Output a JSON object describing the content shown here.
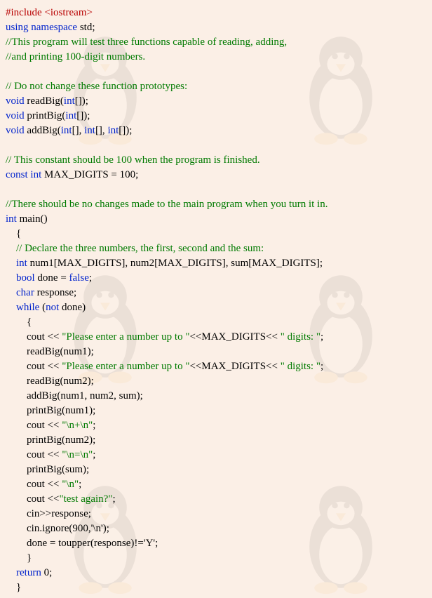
{
  "code": {
    "include_line": "#include <iostream>",
    "using_kw": "using",
    "namespace_kw": "namespace",
    "std_stmt": " std;",
    "c1": "//This program will test three functions capable of reading, adding,",
    "c2": "//and printing 100-digit numbers.",
    "c3": "// Do not change these function prototypes:",
    "void_kw": "void",
    "readBig_proto": " readBig(",
    "int_kw": "int",
    "arr_close": "[]);",
    "printBig_proto": " printBig(",
    "addBig_proto": " addBig(",
    "arr_mid": "[], ",
    "c4": "// This constant should be 100 when the program is finished.",
    "const_kw": "const",
    "max_digits_decl": " MAX_DIGITS = 100;",
    "c5": "//There should be no changes made to the main program when you turn it in.",
    "main_fn": " main()",
    "brace_open": "{",
    "brace_close": "}",
    "c6": "// Declare the three numbers, the first, second and the sum:",
    "decl_arrays": " num1[MAX_DIGITS], num2[MAX_DIGITS], sum[MAX_DIGITS];",
    "bool_kw": "bool",
    "done_false": " done = ",
    "false_kw": "false",
    "semi": ";",
    "char_kw": "char",
    "resp_decl": " response;",
    "while_kw": "while",
    "not_kw": "not",
    "while_rest": " done)",
    "paren_open": " (",
    "cout_txt": "cout << ",
    "str_prompt": "\"Please enter a number up to \"",
    "mid_concat": "<<MAX_DIGITS<< ",
    "str_digits": "\" digits: \"",
    "readBig1": "readBig(num1);",
    "readBig2": "readBig(num2);",
    "addBig_call": "addBig(num1, num2, sum);",
    "printBig1": "printBig(num1);",
    "str_plus": "\"\\n+\\n\"",
    "printBig2": "printBig(num2);",
    "str_eq": "\"\\n=\\n\"",
    "printBigSum": "printBig(sum);",
    "str_nl": "\"\\n\"",
    "cout_open": "cout <<",
    "str_test": "\"test again?\"",
    "cin_resp": "cin>>response;",
    "cin_ignore": "cin.ignore(900,'\\n');",
    "done_assign": "done = toupper(response)!='Y';",
    "return_kw": "return",
    "return_rest": " 0;"
  }
}
